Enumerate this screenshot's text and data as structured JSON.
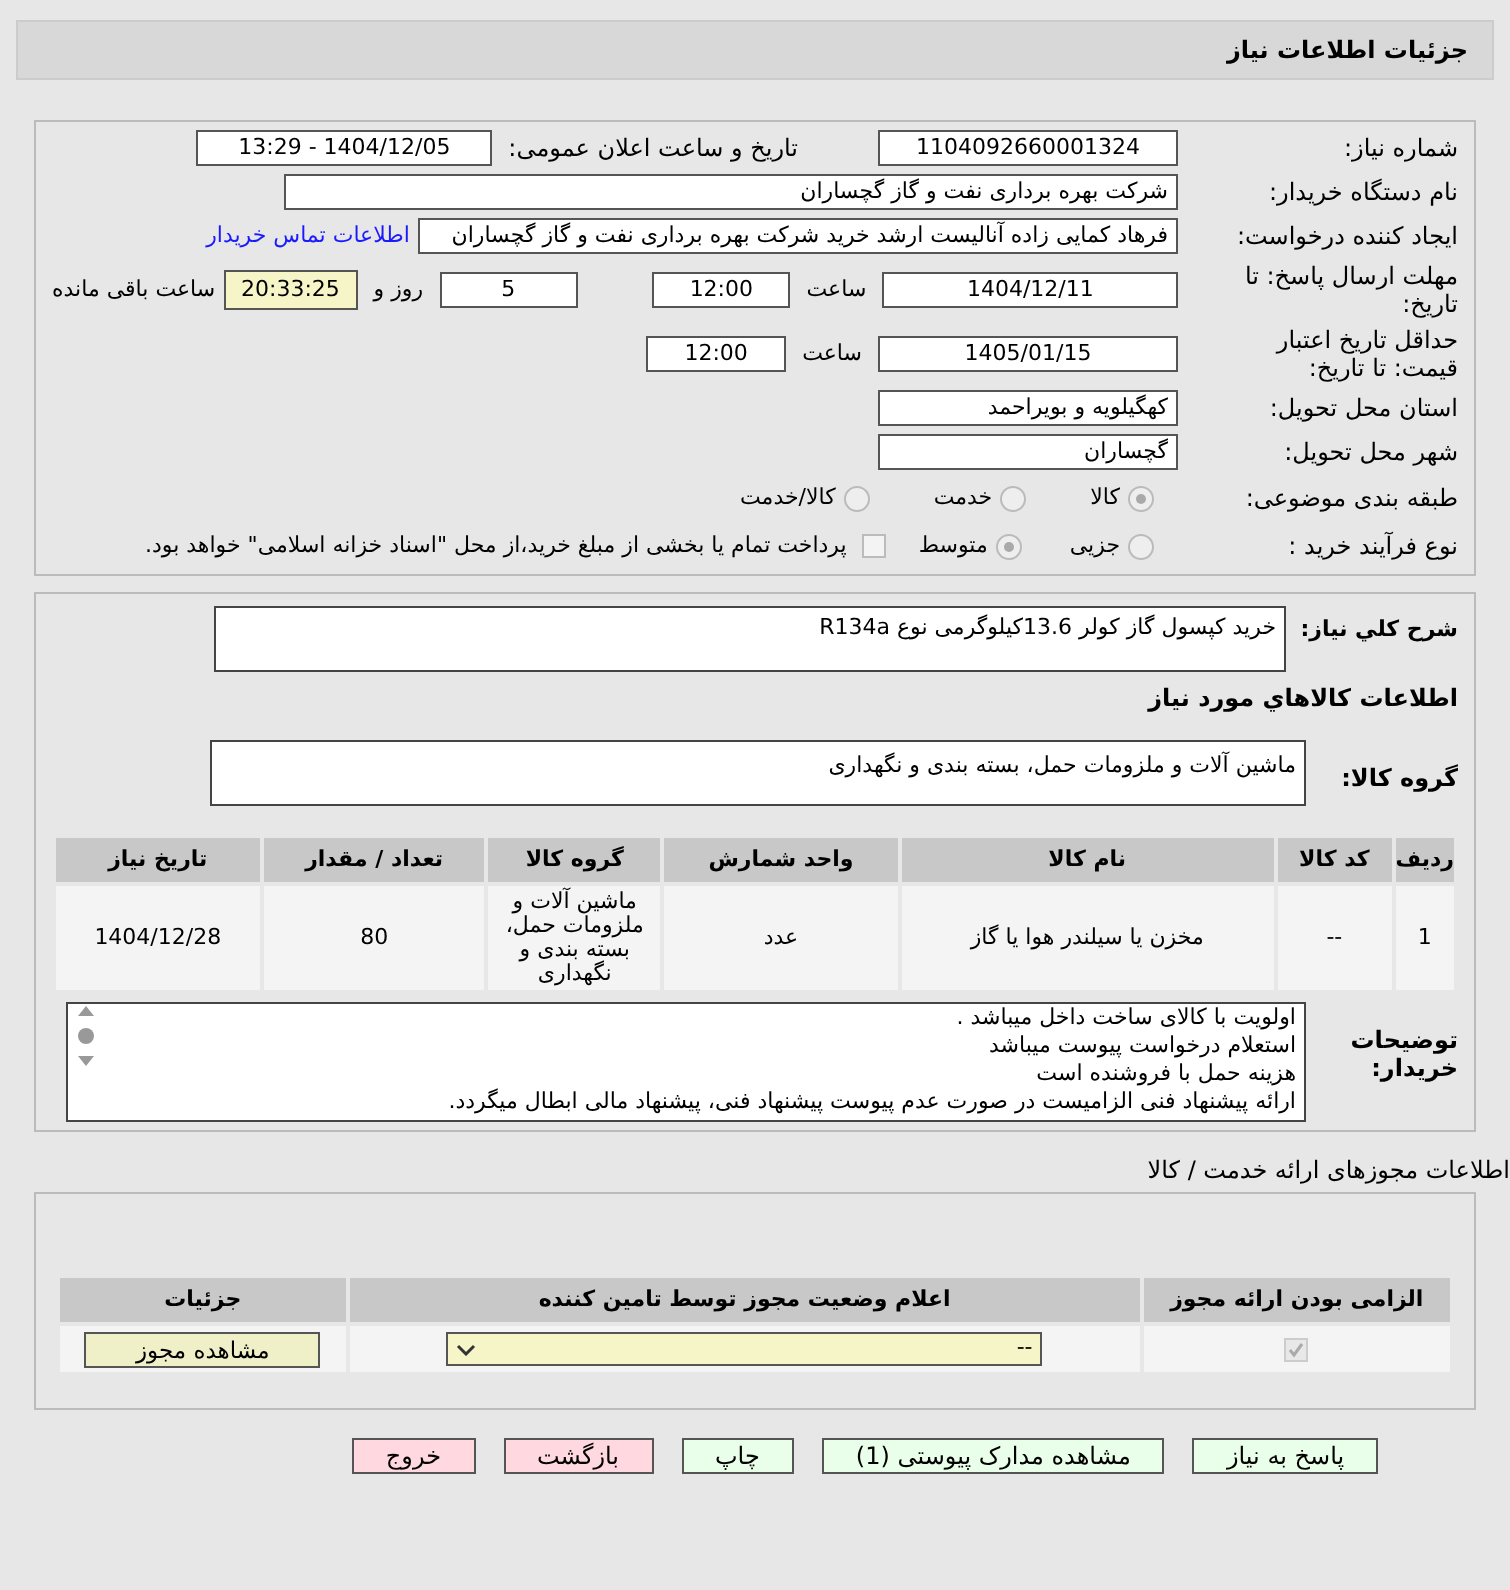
{
  "header": {
    "title": "جزئیات اطلاعات نیاز"
  },
  "info": {
    "need_number": {
      "label": "شماره نیاز:",
      "value": "1104092660001324"
    },
    "announce": {
      "label": "تاریخ و ساعت اعلان عمومی:",
      "value": "1404/12/05 - 13:29"
    },
    "buyer": {
      "label": "نام دستگاه خریدار:",
      "value": "شرکت بهره برداری نفت و گاز گچساران"
    },
    "creator": {
      "label": "ایجاد کننده درخواست:",
      "value": "فرهاد کمایی زاده آنالیست ارشد خرید شرکت بهره برداری نفت و گاز گچساران",
      "link": "اطلاعات تماس خریدار"
    },
    "deadline": {
      "label": "مهلت ارسال پاسخ: تا تاریخ:",
      "date": "1404/12/11",
      "time_label": "ساعت",
      "time": "12:00",
      "days": "5",
      "days_label": "روز و",
      "remaining": "20:33:25",
      "remaining_label": "ساعت باقی مانده"
    },
    "validity": {
      "label": "حداقل تاریخ اعتبار قیمت: تا تاریخ:",
      "date": "1405/01/15",
      "time_label": "ساعت",
      "time": "12:00"
    },
    "province": {
      "label": "استان محل تحویل:",
      "value": "کهگیلویه و بویراحمد"
    },
    "city": {
      "label": "شهر محل تحویل:",
      "value": "گچساران"
    },
    "category": {
      "label": "طبقه بندی موضوعی:",
      "options": [
        {
          "label": "کالا",
          "selected": true
        },
        {
          "label": "خدمت",
          "selected": false
        },
        {
          "label": "کالا/خدمت",
          "selected": false
        }
      ]
    },
    "process": {
      "label": "نوع فرآیند خرید :",
      "options": [
        {
          "label": "جزیی",
          "selected": false
        },
        {
          "label": "متوسط",
          "selected": true
        }
      ],
      "treasury": {
        "label": "پرداخت تمام یا بخشی از مبلغ خرید،از محل \"اسناد خزانه اسلامی\" خواهد بود.",
        "checked": false
      }
    }
  },
  "summary": {
    "label": "شرح کلي نياز:",
    "value": "خرید کپسول گاز کولر 13.6کیلوگرمی نوع R134a"
  },
  "goods_title": "اطلاعات کالاهاي مورد نياز",
  "goods_group": {
    "label": "گروه کالا:",
    "value": "ماشین آلات و ملزومات حمل، بسته بندی و نگهداری"
  },
  "table": {
    "columns": [
      "ردیف",
      "کد کالا",
      "نام کالا",
      "واحد شمارش",
      "گروه کالا",
      "تعداد / مقدار",
      "تاریخ نیاز"
    ],
    "rows": [
      [
        "1",
        "--",
        "مخزن یا سیلندر هوا یا گاز",
        "عدد",
        "ماشین آلات و ملزومات حمل، بسته بندی و نگهداری",
        "80",
        "1404/12/28"
      ]
    ]
  },
  "notes": {
    "label": "توضیحات خریدار:",
    "lines": [
      "اولویت با کالای ساخت داخل میباشد .",
      "استعلام درخواست پیوست میباشد",
      "هزینه حمل با فروشنده است",
      "ارائه پیشنهاد فنی الزامیست در صورت عدم پیوست پیشنهاد فنی، پیشنهاد مالی ابطال میگردد."
    ]
  },
  "permits": {
    "title": "اطلاعات مجوزهای ارائه خدمت / کالا",
    "columns": [
      "الزامی بودن ارائه مجوز",
      "اعلام وضعیت مجوز توسط تامین کننده",
      "جزئیات"
    ],
    "rows": [
      {
        "required": true,
        "status": "--",
        "button": "مشاهده مجوز"
      }
    ]
  },
  "buttons": [
    {
      "label": "پاسخ به نیاز",
      "kind": "green"
    },
    {
      "label": "مشاهده مدارک پیوستی (1)",
      "kind": "green"
    },
    {
      "label": "چاپ",
      "kind": "green"
    },
    {
      "label": "بازگشت",
      "kind": "red"
    },
    {
      "label": "خروج",
      "kind": "red"
    }
  ]
}
